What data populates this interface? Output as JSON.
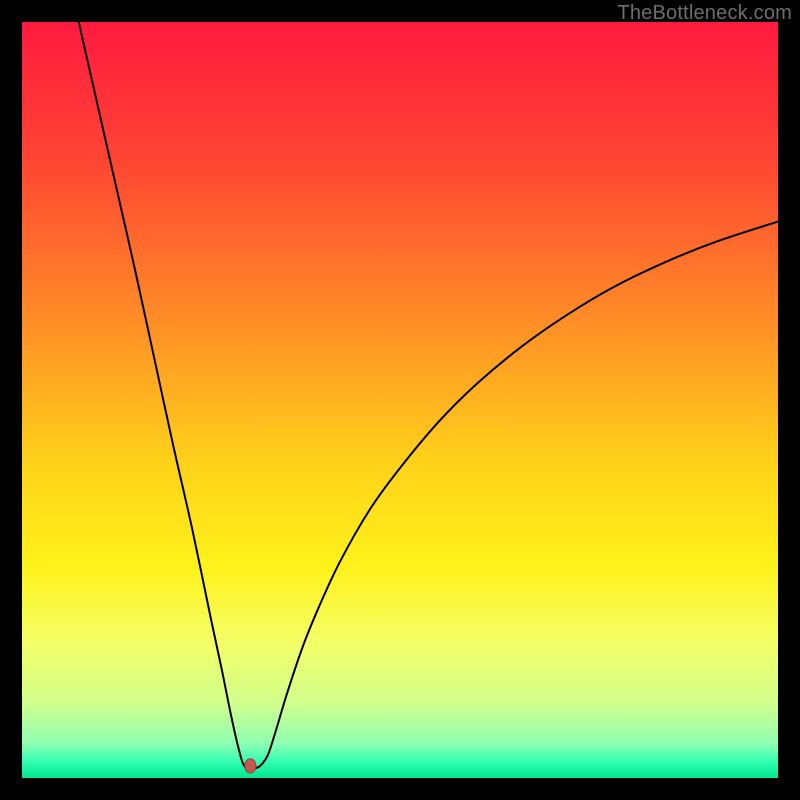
{
  "watermark": "TheBottleneck.com",
  "chart_data": {
    "type": "line",
    "title": "",
    "xlabel": "",
    "ylabel": "",
    "xlim": [
      0,
      100
    ],
    "ylim": [
      0,
      100
    ],
    "background_gradient": {
      "stops": [
        {
          "offset": 0.0,
          "color": "#ff1a3f"
        },
        {
          "offset": 0.18,
          "color": "#ff4433"
        },
        {
          "offset": 0.4,
          "color": "#ff8f26"
        },
        {
          "offset": 0.58,
          "color": "#ffd11a"
        },
        {
          "offset": 0.72,
          "color": "#fff21a"
        },
        {
          "offset": 0.82,
          "color": "#f4ff66"
        },
        {
          "offset": 0.9,
          "color": "#d2ff8c"
        },
        {
          "offset": 0.955,
          "color": "#8dffb2"
        },
        {
          "offset": 0.978,
          "color": "#33ffb3"
        },
        {
          "offset": 1.0,
          "color": "#00e58f"
        }
      ]
    },
    "series": [
      {
        "name": "bottleneck-curve",
        "color": "#000000",
        "x": [
          7.5,
          10,
          12.5,
          15,
          17.5,
          20,
          22.5,
          25,
          26.5,
          27.5,
          28.5,
          29.2,
          29.8,
          30.5,
          31.5,
          32.5,
          33.5,
          35,
          37,
          39,
          42,
          46,
          50,
          55,
          60,
          66,
          72,
          78,
          85,
          92,
          100
        ],
        "y": [
          100,
          89,
          78,
          67,
          55.5,
          44,
          33,
          21,
          14,
          9,
          4.5,
          2,
          1.2,
          1.2,
          1.6,
          3,
          6,
          11,
          17,
          22,
          28.5,
          35.5,
          41,
          47,
          52,
          57,
          61.2,
          64.8,
          68.2,
          71,
          73.6
        ]
      }
    ],
    "marker": {
      "name": "optimal-point",
      "x": 30.2,
      "y": 1.6,
      "rx": 5.6,
      "ry": 7.2,
      "fill": "#c6584c",
      "stroke": "#8a3d34"
    }
  }
}
